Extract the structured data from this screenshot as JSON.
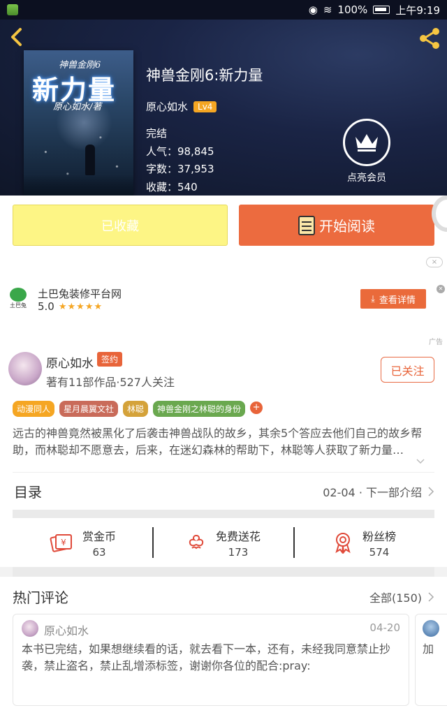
{
  "status_bar": {
    "battery": "100%",
    "time": "上午9:19"
  },
  "book": {
    "cover_series": "神兽金刚6",
    "cover_title": "新力量",
    "cover_author": "原心如水/著",
    "title": "神兽金刚6:新力量",
    "author": "原心如水",
    "author_level": "Lv4",
    "status": "完结",
    "popularity": "人气：98,845",
    "word_count": "字数：37,953",
    "favorites": "收藏：540"
  },
  "vip": {
    "label": "点亮会员"
  },
  "actions": {
    "collected_label": "已收藏",
    "read_label": "开始阅读"
  },
  "ad": {
    "close_label": "×",
    "logo_text": "土巴兔",
    "name": "土巴兔装修平台网",
    "rating": "5.0",
    "stars": "★★★★★",
    "cta": "查看详情",
    "tag": "广告"
  },
  "author_card": {
    "name": "原心如水",
    "badge": "签约",
    "works": "著有11部作品·527人关注",
    "follow_label": "已关注"
  },
  "tags": [
    {
      "label": "动漫同人",
      "color": "#f5a623"
    },
    {
      "label": "星月晨翼文社",
      "color": "#c96b5a"
    },
    {
      "label": "林聪",
      "color": "#d4a23a"
    },
    {
      "label": "神兽金刚之林聪的身份",
      "color": "#6aa84f"
    }
  ],
  "tag_more": "+",
  "synopsis": "远古的神兽竟然被黑化了后袭击神兽战队的故乡，其余5个答应去他们自己的故乡帮助，而林聪却不愿意去，后来，在迷幻森林的帮助下，林聪等人获取了新力量…",
  "toc": {
    "label": "目录",
    "latest": "02-04 · 下一部介绍"
  },
  "stats": [
    {
      "label": "赏金币",
      "value": "63"
    },
    {
      "label": "免费送花",
      "value": "173"
    },
    {
      "label": "粉丝榜",
      "value": "574"
    }
  ],
  "comments": {
    "title": "热门评论",
    "all_label": "全部(150)",
    "items": [
      {
        "user": "原心如水",
        "date": "04-20",
        "text": "本书已完结，如果想继续看的话，就去看下一本，还有，未经我同意禁止抄袭，禁止盗名，禁止乱增添标签，谢谢你各位的配合:pray:"
      },
      {
        "text": "加"
      }
    ]
  },
  "colors": {
    "accent": "#ec6b3f",
    "collected_bg": "#fdf585",
    "hero_bg": "#1a2445"
  }
}
